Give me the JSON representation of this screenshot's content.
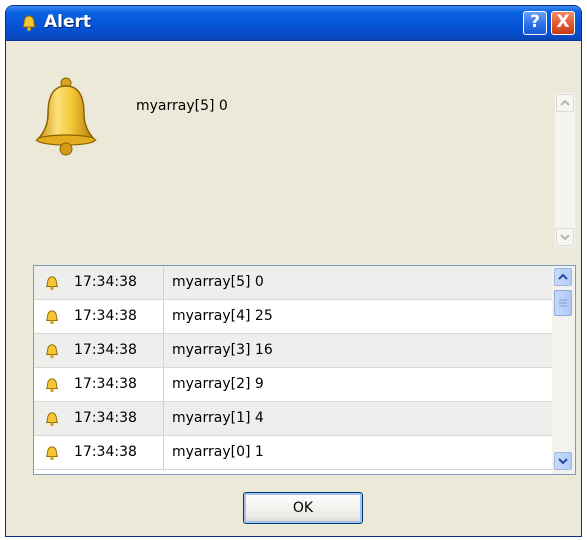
{
  "window": {
    "title": "Alert",
    "help_glyph": "?",
    "close_glyph": "X"
  },
  "message": {
    "icon": "bell-icon",
    "text": "myarray[5] 0"
  },
  "log": {
    "rows": [
      {
        "time": "17:34:38",
        "text": "myarray[5] 0"
      },
      {
        "time": "17:34:38",
        "text": "myarray[4] 25"
      },
      {
        "time": "17:34:38",
        "text": "myarray[3] 16"
      },
      {
        "time": "17:34:38",
        "text": "myarray[2] 9"
      },
      {
        "time": "17:34:38",
        "text": "myarray[1] 4"
      },
      {
        "time": "17:34:38",
        "text": "myarray[0] 1"
      }
    ]
  },
  "buttons": {
    "ok_label": "OK"
  },
  "colors": {
    "titlebar": "#0653d6",
    "window_bg": "#ece9d8",
    "bell": "#e8b820"
  }
}
